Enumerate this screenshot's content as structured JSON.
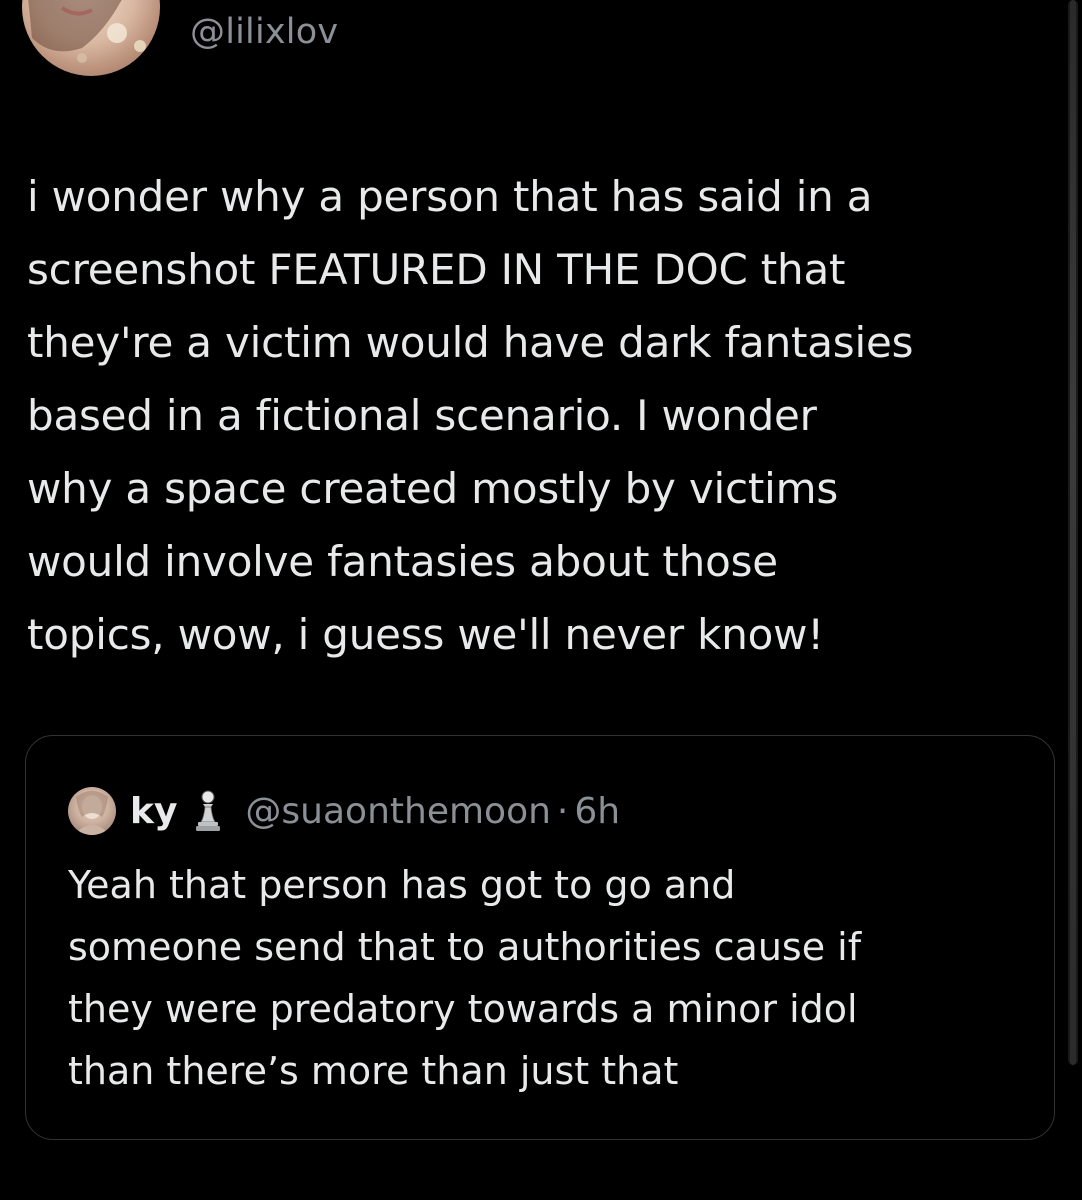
{
  "tweet": {
    "author_handle": "@lilixlov",
    "text_lines": [
      "i wonder why a person that has said in a",
      "screenshot FEATURED IN THE DOC that",
      "they're a victim would have dark fantasies",
      "based in a fictional scenario. I wonder",
      "why a space created mostly by victims",
      "would involve fantasies about those",
      "topics, wow, i guess we'll never know!"
    ]
  },
  "quoted_tweet": {
    "display_name": "ky",
    "badge_icon": "chess-pawn-icon",
    "handle": "@suaonthemoon",
    "separator": "·",
    "time": "6h",
    "text_lines": [
      "Yeah that person has got to go and",
      "someone send that to authorities cause if",
      "they were predatory towards a minor idol",
      "than there’s more than just that"
    ]
  },
  "colors": {
    "background": "#000000",
    "text_primary": "#e7e9ea",
    "text_secondary": "#8b9096",
    "border": "#2f3336"
  }
}
